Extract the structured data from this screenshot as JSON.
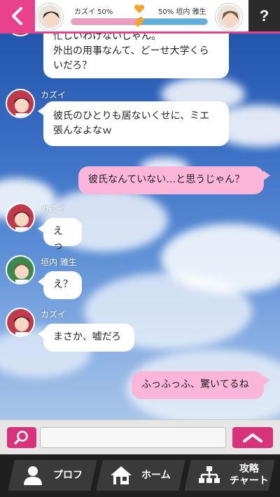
{
  "header": {
    "left_name": "カズイ 50%",
    "right_name": "50% 垣内 雅生",
    "left_percent": 50,
    "right_percent": 50,
    "help_label": "?"
  },
  "messages": [
    {
      "speaker": "",
      "text_lines": [
        "忙しいわけないじゃん。",
        "外出の用事なんて、どーせ大学くら",
        "いだろ？"
      ],
      "side": "left"
    },
    {
      "speaker": "カズイ",
      "text_lines": [
        "彼氏のひとりも居ないくせに、ミエ",
        "張んなよなｗ"
      ],
      "side": "left"
    },
    {
      "speaker": "",
      "text_lines": [
        "彼氏なんていない…と思うじゃん？"
      ],
      "side": "right"
    },
    {
      "speaker": "カズイ",
      "text_lines": [
        "えっ"
      ],
      "side": "left"
    },
    {
      "speaker": "垣内 雅生",
      "text_lines": [
        "え？"
      ],
      "side": "left"
    },
    {
      "speaker": "カズイ",
      "text_lines": [
        "まさか、嘘だろ"
      ],
      "side": "left"
    },
    {
      "speaker": "",
      "text_lines": [
        "ふっふっふ、驚いてるね"
      ],
      "side": "right"
    }
  ],
  "input": {
    "value": "",
    "placeholder": ""
  },
  "nav": {
    "profile_label": "プロフ",
    "home_label": "ホーム",
    "chart_label_1": "攻略",
    "chart_label_2": "チャート"
  },
  "icons": {
    "back": "chevron-left-icon",
    "help": "question-icon",
    "heart": "heart-icon",
    "search": "magnifier-icon",
    "expand": "chevron-up-icon",
    "profile": "person-icon",
    "home": "house-icon",
    "chart": "flowchart-icon"
  },
  "colors": {
    "accent": "#e8418d",
    "self_bubble": "#fbb5d9",
    "other_bubble": "#ffffff",
    "nav_bg": "#1f1f1f"
  }
}
